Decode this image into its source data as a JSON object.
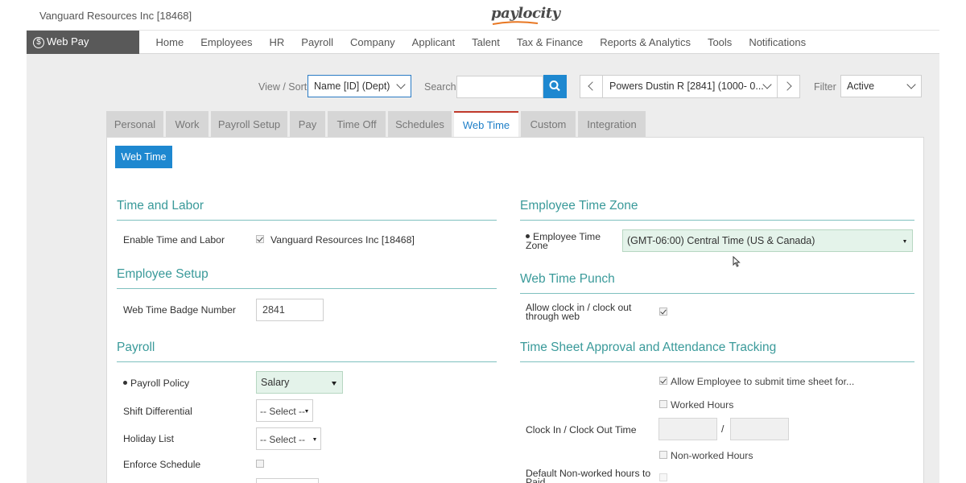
{
  "header": {
    "company": "Vanguard Resources Inc [18468]",
    "logo_text": "paylocity"
  },
  "nav": {
    "module_label": "Web Pay",
    "items": [
      "Home",
      "Employees",
      "HR",
      "Payroll",
      "Company",
      "Applicant",
      "Talent",
      "Tax & Finance",
      "Reports & Analytics",
      "Tools",
      "Notifications"
    ]
  },
  "filters": {
    "view_sort_label": "View / Sort",
    "view_sort_value": "Name [ID] (Dept)",
    "search_label": "Search",
    "search_value": "",
    "employee_value": "Powers Dustin R [2841] (1000- 0...",
    "filter_label": "Filter",
    "filter_value": "Active"
  },
  "tabs": [
    "Personal",
    "Work",
    "Payroll Setup",
    "Pay",
    "Time Off",
    "Schedules",
    "Web Time",
    "Custom",
    "Integration"
  ],
  "active_tab": "Web Time",
  "subbutton": "Web Time",
  "left": {
    "time_labor": {
      "title": "Time and Labor",
      "enable_label": "Enable Time and Labor",
      "enable_checked": true,
      "enable_value": "Vanguard Resources Inc [18468]"
    },
    "employee_setup": {
      "title": "Employee Setup",
      "badge_label": "Web Time Badge Number",
      "badge_value": "2841"
    },
    "payroll": {
      "title": "Payroll",
      "policy_label": "Payroll Policy",
      "policy_value": "Salary",
      "shift_label": "Shift Differential",
      "shift_value": "-- Select --",
      "holiday_label": "Holiday List",
      "holiday_value": "-- Select --",
      "enforce_label": "Enforce Schedule",
      "enforce_checked": false
    }
  },
  "right": {
    "timezone": {
      "title": "Employee Time Zone",
      "label_line1": "Employee Time",
      "label_line2": "Zone",
      "value": "(GMT-06:00) Central Time (US & Canada)"
    },
    "punch": {
      "title": "Web Time Punch",
      "label_line1": "Allow clock in / clock out",
      "label_line2": "through web",
      "checked": true
    },
    "approval": {
      "title": "Time Sheet Approval and Attendance Tracking",
      "allow_submit": "Allow Employee to submit time sheet for...",
      "allow_submit_checked": true,
      "worked_hours": "Worked Hours",
      "worked_checked": false,
      "clock_label": "Clock In / Clock Out Time",
      "separator": "/",
      "nonworked_hours": "Non-worked Hours",
      "nonworked_checked": false,
      "default_label_line1": "Default Non-worked hours to",
      "default_label_line2": "Paid"
    }
  },
  "colors": {
    "accent": "#1e88d0",
    "section_title": "#3a9a9a",
    "active_tab_border": "#c0392b",
    "module_bg": "#595959"
  }
}
